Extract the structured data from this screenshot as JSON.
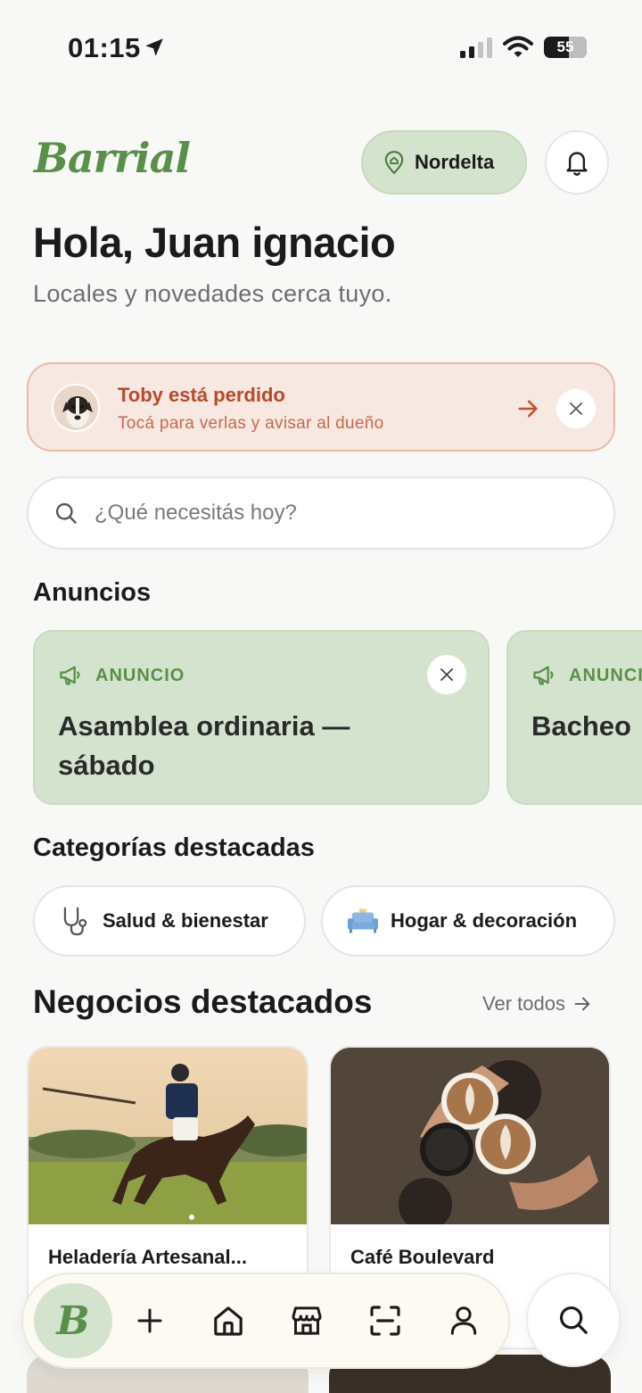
{
  "status_bar": {
    "time": "01:15",
    "battery": "55"
  },
  "header": {
    "logo": "Barrial",
    "location": "Nordelta"
  },
  "greeting": {
    "title": "Hola, Juan ignacio",
    "subtitle": "Locales y novedades cerca tuyo."
  },
  "lost_pet": {
    "title": "Toby está perdido",
    "subtitle": "Tocá para verlas y avisar al dueño"
  },
  "search": {
    "placeholder": "¿Qué necesitás hoy?"
  },
  "announcements": {
    "section_title": "Anuncios",
    "items": [
      {
        "tag": "ANUNCIO",
        "title_line1": "Asamblea ordinaria —",
        "title_line2": "sábado"
      },
      {
        "tag": "ANUNCIO",
        "title_line1": "Bacheo"
      }
    ]
  },
  "categories": {
    "section_title": "Categorías destacadas",
    "items": [
      {
        "label": "Salud & bienestar",
        "icon": "stethoscope-icon"
      },
      {
        "label": "Hogar & decoración",
        "icon": "sofa-icon"
      }
    ]
  },
  "businesses": {
    "section_title": "Negocios destacados",
    "see_all": "Ver todos",
    "items": [
      {
        "name": "Heladería Artesanal...",
        "image": "polo-player-photo"
      },
      {
        "name": "Café Boulevard",
        "image": "coffee-cups-photo"
      }
    ]
  },
  "tabbar": {
    "items": [
      "home-logo",
      "add",
      "home",
      "store",
      "scan",
      "profile"
    ],
    "logo_letter": "B"
  },
  "colors": {
    "brand_green": "#5a8f4a",
    "pill_green": "#d4e3cd",
    "alert_orange": "#b9492a",
    "alert_bg": "#f7e8e2"
  }
}
